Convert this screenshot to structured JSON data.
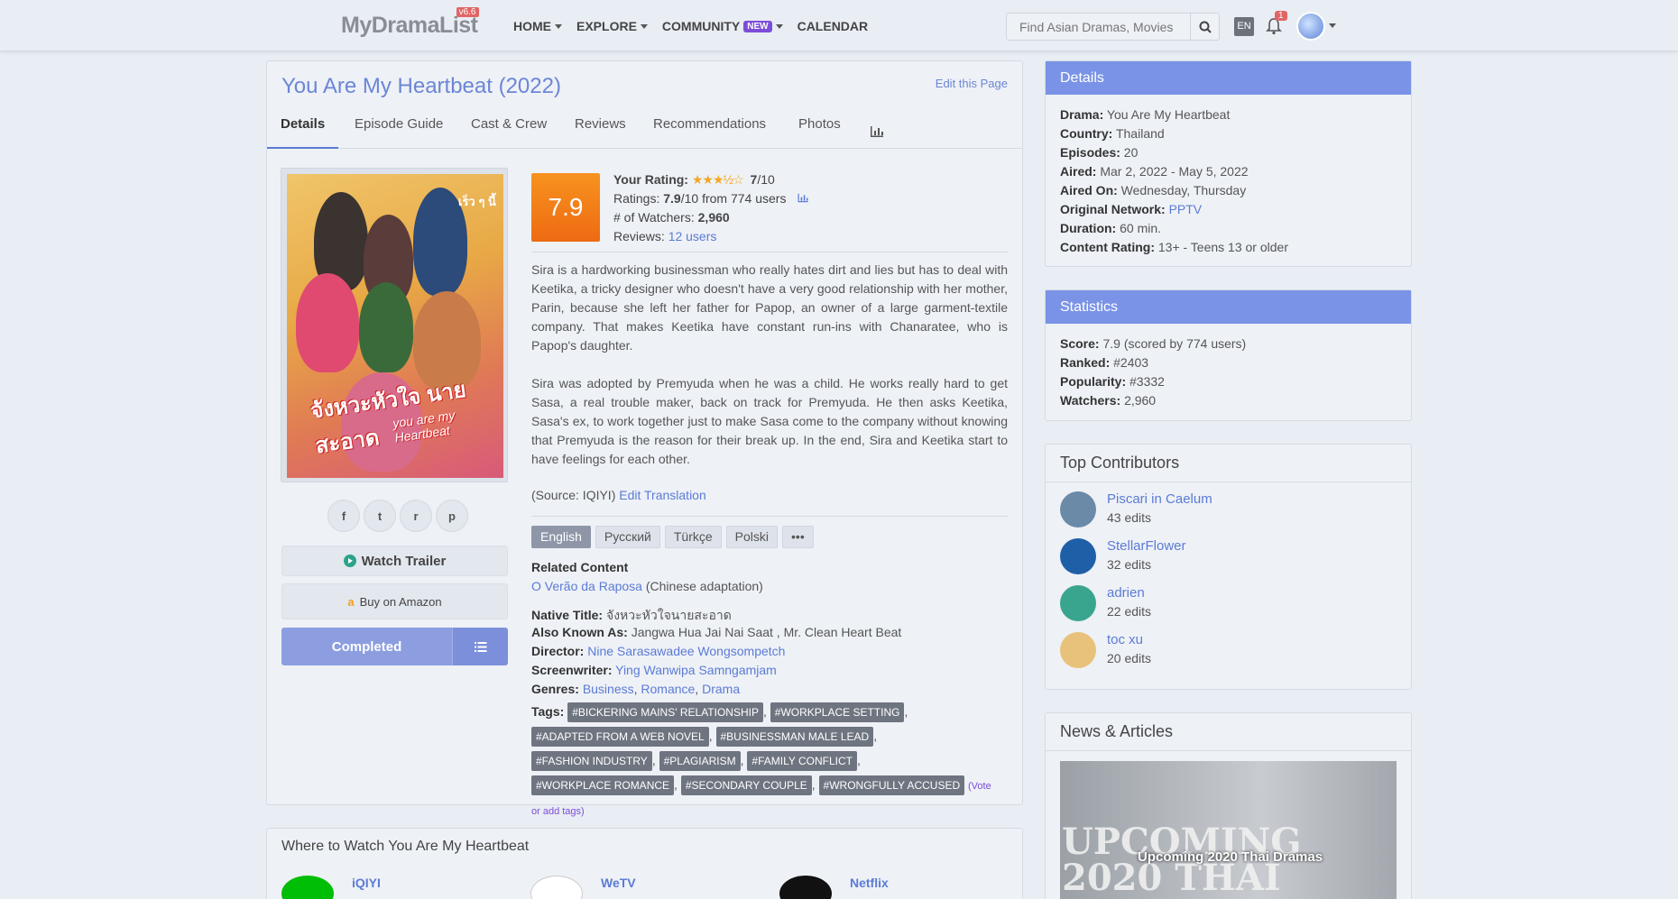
{
  "header": {
    "logo": "MyDramaList",
    "version": "v6.6",
    "nav": [
      {
        "label": "HOME",
        "dropdown": true
      },
      {
        "label": "EXPLORE",
        "dropdown": true
      },
      {
        "label": "COMMUNITY",
        "badge": "NEW",
        "dropdown": true
      },
      {
        "label": "CALENDAR",
        "dropdown": false
      }
    ],
    "search_placeholder": "Find Asian Dramas, Movies",
    "lang": "EN",
    "notifications": "1"
  },
  "page": {
    "title": "You Are My Heartbeat (2022)",
    "edit_link": "Edit this Page",
    "tabs": [
      "Details",
      "Episode Guide",
      "Cast & Crew",
      "Reviews",
      "Recommendations",
      "Photos"
    ],
    "active_tab": "Details",
    "stats_icon": "bar-chart-icon"
  },
  "poster": {
    "title_thai": "จังหวะหัวใจ นายสะอาด",
    "subtitle": "you are my Heartbeat",
    "corner": "เร็ว ๆ นี้"
  },
  "social": [
    "f",
    "t",
    "r",
    "p"
  ],
  "buttons": {
    "watch_trailer": "Watch Trailer",
    "buy_amazon": "Buy on Amazon",
    "completed": "Completed"
  },
  "rating": {
    "score": "7.9",
    "your_rating_label": "Your Rating:",
    "your_rating_stars": 3.5,
    "your_rating_value": "7",
    "your_rating_suffix": "/10",
    "ratings_label": "Ratings:",
    "ratings_value": "7.9",
    "ratings_suffix": "/10 from 774 users",
    "watchers_label": "# of Watchers:",
    "watchers_value": "2,960",
    "reviews_label": "Reviews:",
    "reviews_value": "12 users"
  },
  "synopsis": [
    "Sira is a hardworking businessman who really hates dirt and lies but has to deal with Keetika, a tricky designer who doesn't have a very good relationship with her mother, Parin, because she left her father for Papop, an owner of a large garment-textile company. That makes Keetika have constant run-ins with Chanaratee, who is Papop's daughter.",
    "Sira was adopted by Premyuda when he was a child. He works really hard to get Sasa, a real trouble maker, back on track for Premyuda. He then asks Keetika, Sasa's ex, to work together just to make Sasa come to the company without knowing that Premyuda is the reason for their break up. In the end, Sira and Keetika start to have feelings for each other."
  ],
  "source": {
    "text": "(Source: IQIYI)",
    "link": "Edit Translation"
  },
  "languages": [
    "English",
    "Русский",
    "Türkçe",
    "Polski",
    "•••"
  ],
  "related": {
    "heading": "Related Content",
    "link": "O Verão da Raposa",
    "note": "(Chinese adaptation)"
  },
  "details": {
    "native_title_label": "Native Title:",
    "native_title": "จังหวะหัวใจนายสะอาด",
    "aka_label": "Also Known As:",
    "aka": "Jangwa Hua Jai Nai Saat , Mr. Clean Heart Beat",
    "director_label": "Director:",
    "director": "Nine Sarasawadee Wongsompetch",
    "screenwriter_label": "Screenwriter:",
    "screenwriter": "Ying Wanwipa Samngamjam",
    "genres_label": "Genres:",
    "genres": [
      "Business",
      "Romance",
      "Drama"
    ],
    "tags_label": "Tags:",
    "tags": [
      "#BICKERING MAINS' RELATIONSHIP",
      "#WORKPLACE SETTING",
      "#ADAPTED FROM A WEB NOVEL",
      "#BUSINESSMAN MALE LEAD",
      "#FASHION INDUSTRY",
      "#PLAGIARISM",
      "#FAMILY CONFLICT",
      "#WORKPLACE ROMANCE",
      "#SECONDARY COUPLE",
      "#WRONGFULLY ACCUSED"
    ],
    "vote_tags": "(Vote or add tags)"
  },
  "where": {
    "title": "Where to Watch You Are My Heartbeat",
    "services": [
      "iQIYI",
      "WeTV",
      "Netflix"
    ]
  },
  "sidebar": {
    "details": {
      "heading": "Details",
      "rows": [
        {
          "label": "Drama:",
          "value": "You Are My Heartbeat"
        },
        {
          "label": "Country:",
          "value": "Thailand"
        },
        {
          "label": "Episodes:",
          "value": "20"
        },
        {
          "label": "Aired:",
          "value": "Mar 2, 2022 - May 5, 2022"
        },
        {
          "label": "Aired On:",
          "value": "Wednesday, Thursday"
        },
        {
          "label": "Original Network:",
          "value": "PPTV"
        },
        {
          "label": "Duration:",
          "value": "60 min."
        },
        {
          "label": "Content Rating:",
          "value": "13+ - Teens 13 or older"
        }
      ]
    },
    "statistics": {
      "heading": "Statistics",
      "rows": [
        {
          "label": "Score:",
          "value": "7.9 (scored by 774 users)"
        },
        {
          "label": "Ranked:",
          "value": "#2403"
        },
        {
          "label": "Popularity:",
          "value": "#3332"
        },
        {
          "label": "Watchers:",
          "value": "2,960"
        }
      ]
    },
    "contributors": {
      "heading": "Top Contributors",
      "items": [
        {
          "name": "Piscari in Caelum",
          "edits": "43 edits",
          "color": "#6a8aa8"
        },
        {
          "name": "StellarFlower",
          "edits": "32 edits",
          "color": "#1f5fa8"
        },
        {
          "name": "adrien",
          "edits": "22 edits",
          "color": "#3aa58f"
        },
        {
          "name": "toc xu",
          "edits": "20 edits",
          "color": "#e8c27a"
        }
      ]
    },
    "news": {
      "heading": "News & Articles",
      "image_text": "UPCOMING 2020 THAI DRAMAS",
      "caption": "Upcoming 2020 Thai Dramas"
    }
  }
}
